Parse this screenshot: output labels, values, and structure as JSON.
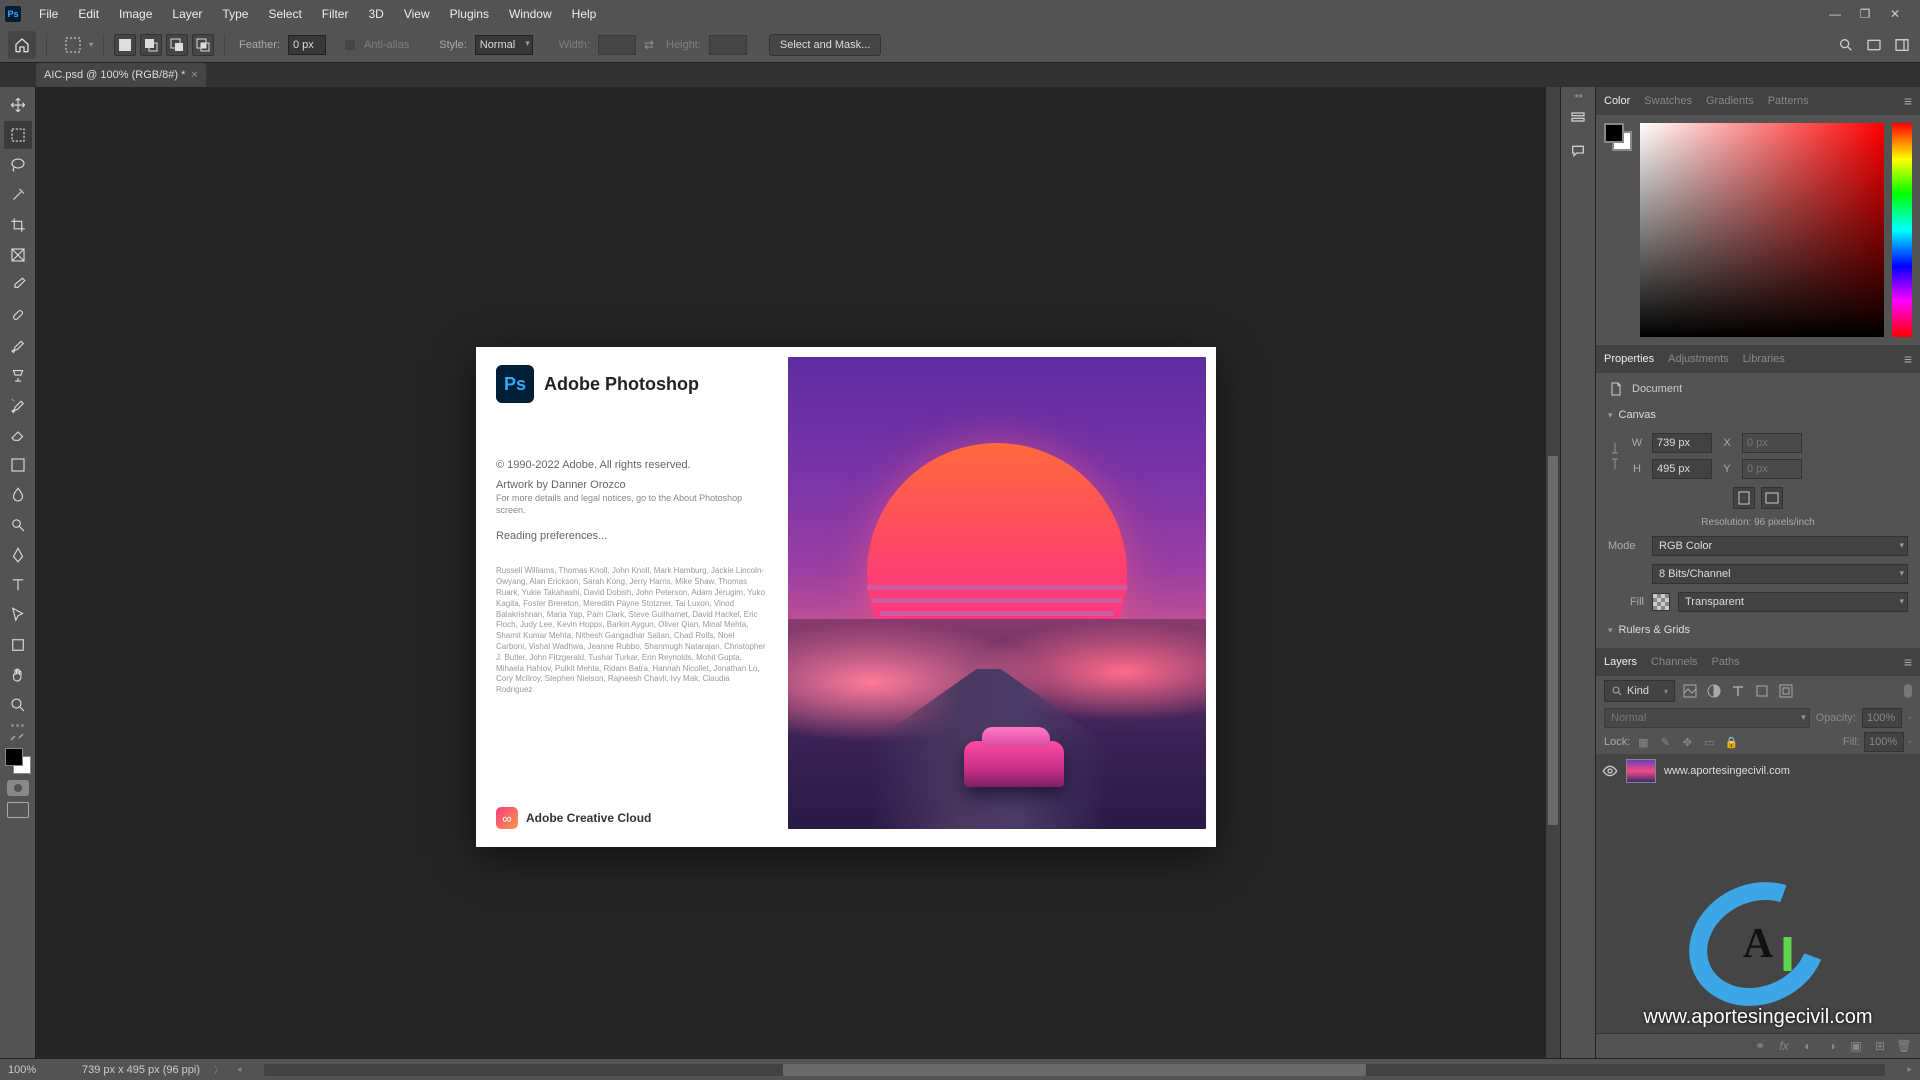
{
  "colors": {
    "accent": "#31a8ff",
    "bg_dark": "#262626",
    "panel": "#535353"
  },
  "menubar": {
    "items": [
      "File",
      "Edit",
      "Image",
      "Layer",
      "Type",
      "Select",
      "Filter",
      "3D",
      "View",
      "Plugins",
      "Window",
      "Help"
    ]
  },
  "optbar": {
    "feather_label": "Feather:",
    "feather_value": "0 px",
    "antialias_label": "Anti-alias",
    "style_label": "Style:",
    "style_value": "Normal",
    "width_label": "Width:",
    "height_label": "Height:",
    "select_mask": "Select and Mask..."
  },
  "doctab": {
    "title": "AIC.psd @ 100% (RGB/8#) *"
  },
  "tools": {
    "names": [
      "move",
      "marquee",
      "lasso",
      "wand",
      "crop",
      "frame",
      "eyedropper",
      "healing",
      "brush",
      "clone",
      "history-brush",
      "eraser",
      "gradient",
      "blur",
      "dodge",
      "pen",
      "type",
      "path-select",
      "rectangle",
      "hand",
      "zoom"
    ]
  },
  "right": {
    "color_tabs": [
      "Color",
      "Swatches",
      "Gradients",
      "Patterns"
    ],
    "props_tabs": [
      "Properties",
      "Adjustments",
      "Libraries"
    ],
    "props": {
      "doc_label": "Document",
      "canvas_label": "Canvas",
      "rulers_label": "Rulers & Grids",
      "w_label": "W",
      "w_val": "739 px",
      "h_label": "H",
      "h_val": "495 px",
      "x_label": "X",
      "x_val": "0 px",
      "y_label": "Y",
      "y_val": "0 px",
      "res_label": "Resolution: 96 pixels/inch",
      "mode_label": "Mode",
      "mode_val": "RGB Color",
      "depth_val": "8 Bits/Channel",
      "fill_label": "Fill",
      "fill_val": "Transparent"
    },
    "layers_tabs": [
      "Layers",
      "Channels",
      "Paths"
    ],
    "layers": {
      "filter_label": "Kind",
      "blend_val": "Normal",
      "opacity_label": "Opacity:",
      "opacity_val": "100%",
      "lock_label": "Lock:",
      "fill_label": "Fill:",
      "fill_val": "100%",
      "items": [
        {
          "name": "www.aportesingecivil.com"
        }
      ],
      "watermark_url": "www.aportesingecivil.com"
    }
  },
  "splash": {
    "app": "Adobe Photoshop",
    "copyright": "© 1990-2022 Adobe. All rights reserved.",
    "artwork": "Artwork by Danner Orozco",
    "fineprint": "For more details and legal notices, go to the About Photoshop screen.",
    "status": "Reading preferences...",
    "credits": "Russell Williams, Thomas Knoll, John Knoll, Mark Hamburg, Jackie Lincoln-Owyang, Alan Erickson, Sarah Kong, Jerry Harris, Mike Shaw, Thomas Ruark, Yukie Takahashi, David Dobish, John Peterson, Adam Jerugim, Yuko Kagita, Foster Brereton, Meredith Payne Stotzner, Tai Luxon, Vinod Balakrishnan, Maria Yap, Pam Clark, Steve Guilhamet, David Hackel, Eric Floch, Judy Lee, Kevin Hopps, Barkin Aygun, Oliver Qian, Minal Mehta, Shamit Kumar Mehta, Nithesh Gangadhar Salian, Chad Rolfs, Noel Carboni, Vishal Wadhwa, Jeanne Rubbo, Shanmugh Natarajan, Christopher J. Butler, John Fitzgerald, Tushar Turkar, Erin Reynolds, Mohit Gupta, Mihaela Hahlov, Pulkit Mehta, Ridam Batra, Hannah Nicollet, Jonathan Lo, Cory McIlroy, Stephen Nielson, Rajneesh Chavli, Ivy Mak, Claudia Rodriguez",
    "cc": "Adobe Creative Cloud"
  },
  "status": {
    "zoom": "100%",
    "doc_info": "739 px x 495 px (96 ppi)"
  }
}
